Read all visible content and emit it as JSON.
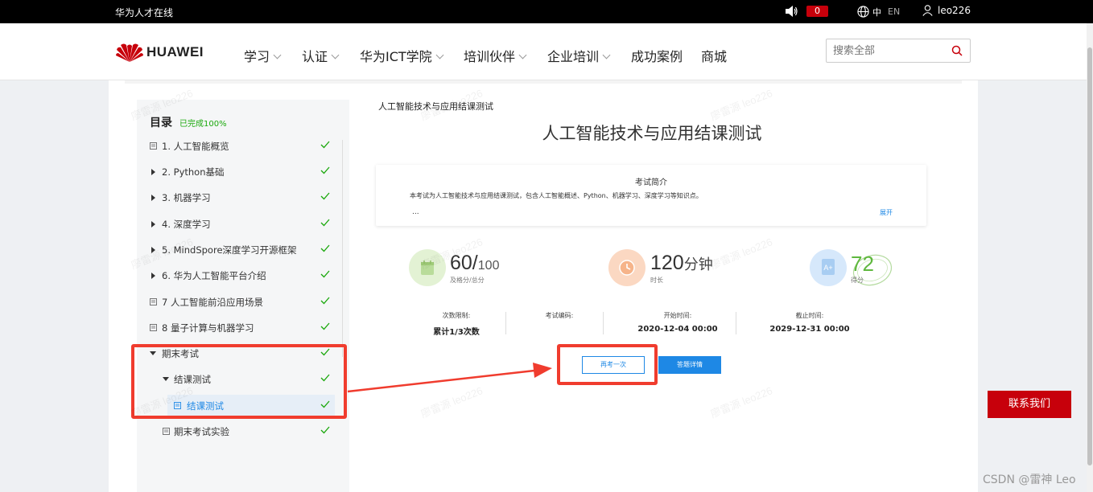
{
  "topbar": {
    "site_name": "华为人才在线",
    "notification_count": "0",
    "lang_cn": "中",
    "lang_en": "EN",
    "username": "leo226"
  },
  "header": {
    "logo_text": "HUAWEI",
    "nav": [
      {
        "label": "学习",
        "dropdown": true
      },
      {
        "label": "认证",
        "dropdown": true
      },
      {
        "label": "华为ICT学院",
        "dropdown": true
      },
      {
        "label": "培训伙伴",
        "dropdown": true
      },
      {
        "label": "企业培训",
        "dropdown": true
      },
      {
        "label": "成功案例",
        "dropdown": false
      },
      {
        "label": "商城",
        "dropdown": false
      }
    ],
    "search_placeholder": "搜索全部"
  },
  "sidebar": {
    "title": "目录",
    "progress": "已完成100%",
    "items": [
      {
        "label": "1. 人工智能概览",
        "icon": "doc-icon",
        "completed": true
      },
      {
        "label": "2. Python基础",
        "icon": "expand-arrow-icon",
        "completed": true
      },
      {
        "label": "3. 机器学习",
        "icon": "expand-arrow-icon",
        "completed": true
      },
      {
        "label": "4. 深度学习",
        "icon": "expand-arrow-icon",
        "completed": true
      },
      {
        "label": "5. MindSpore深度学习开源框架",
        "icon": "expand-arrow-icon",
        "completed": true
      },
      {
        "label": "6. 华为人工智能平台介绍",
        "icon": "expand-arrow-icon",
        "completed": true
      },
      {
        "label": "7 人工智能前沿应用场景",
        "icon": "doc-icon",
        "completed": true
      },
      {
        "label": "8 量子计算与机器学习",
        "icon": "doc-icon",
        "completed": true
      },
      {
        "label": "期末考试",
        "icon": "collapse-arrow-icon",
        "completed": true
      },
      {
        "label": "结课测试",
        "icon": "collapse-arrow-icon",
        "completed": true
      },
      {
        "label": "结课测试",
        "icon": "doc-icon",
        "completed": true,
        "active": true
      },
      {
        "label": "期末考试实验",
        "icon": "doc-icon",
        "completed": true
      }
    ]
  },
  "main": {
    "breadcrumb": "人工智能技术与应用结课测试",
    "title": "人工智能技术与应用结课测试",
    "intro": {
      "heading": "考试简介",
      "text": "本考试为人工智能技术与应用结课测试，包含人工智能概述、Python、机器学习、深度学习等知识点。",
      "ellipsis": "...",
      "expand_label": "展开"
    },
    "stats": {
      "pass": {
        "value": "60/",
        "total": "100",
        "label": "及格分/总分"
      },
      "duration": {
        "value": "120",
        "unit": "分钟",
        "label": "时长"
      },
      "score": {
        "value": "72",
        "label": "得分"
      }
    },
    "info": [
      {
        "key": "次数限制:",
        "value": "累计1/3次数"
      },
      {
        "key": "考试编码:",
        "value": ""
      },
      {
        "key": "开始时间:",
        "value": "2020-12-04 00:00"
      },
      {
        "key": "截止时间:",
        "value": "2029-12-31 00:00"
      }
    ],
    "buttons": {
      "retry": "再考一次",
      "detail": "答题详情"
    }
  },
  "contact_button": "联系我们",
  "watermark": "廖雷源 leo226",
  "csdn_watermark": "CSDN @雷神 Leo",
  "colors": {
    "brand_red": "#c7000b",
    "primary_blue": "#1e88e5",
    "success_green": "#1aa80c",
    "annotation_red": "#f03c2e"
  }
}
